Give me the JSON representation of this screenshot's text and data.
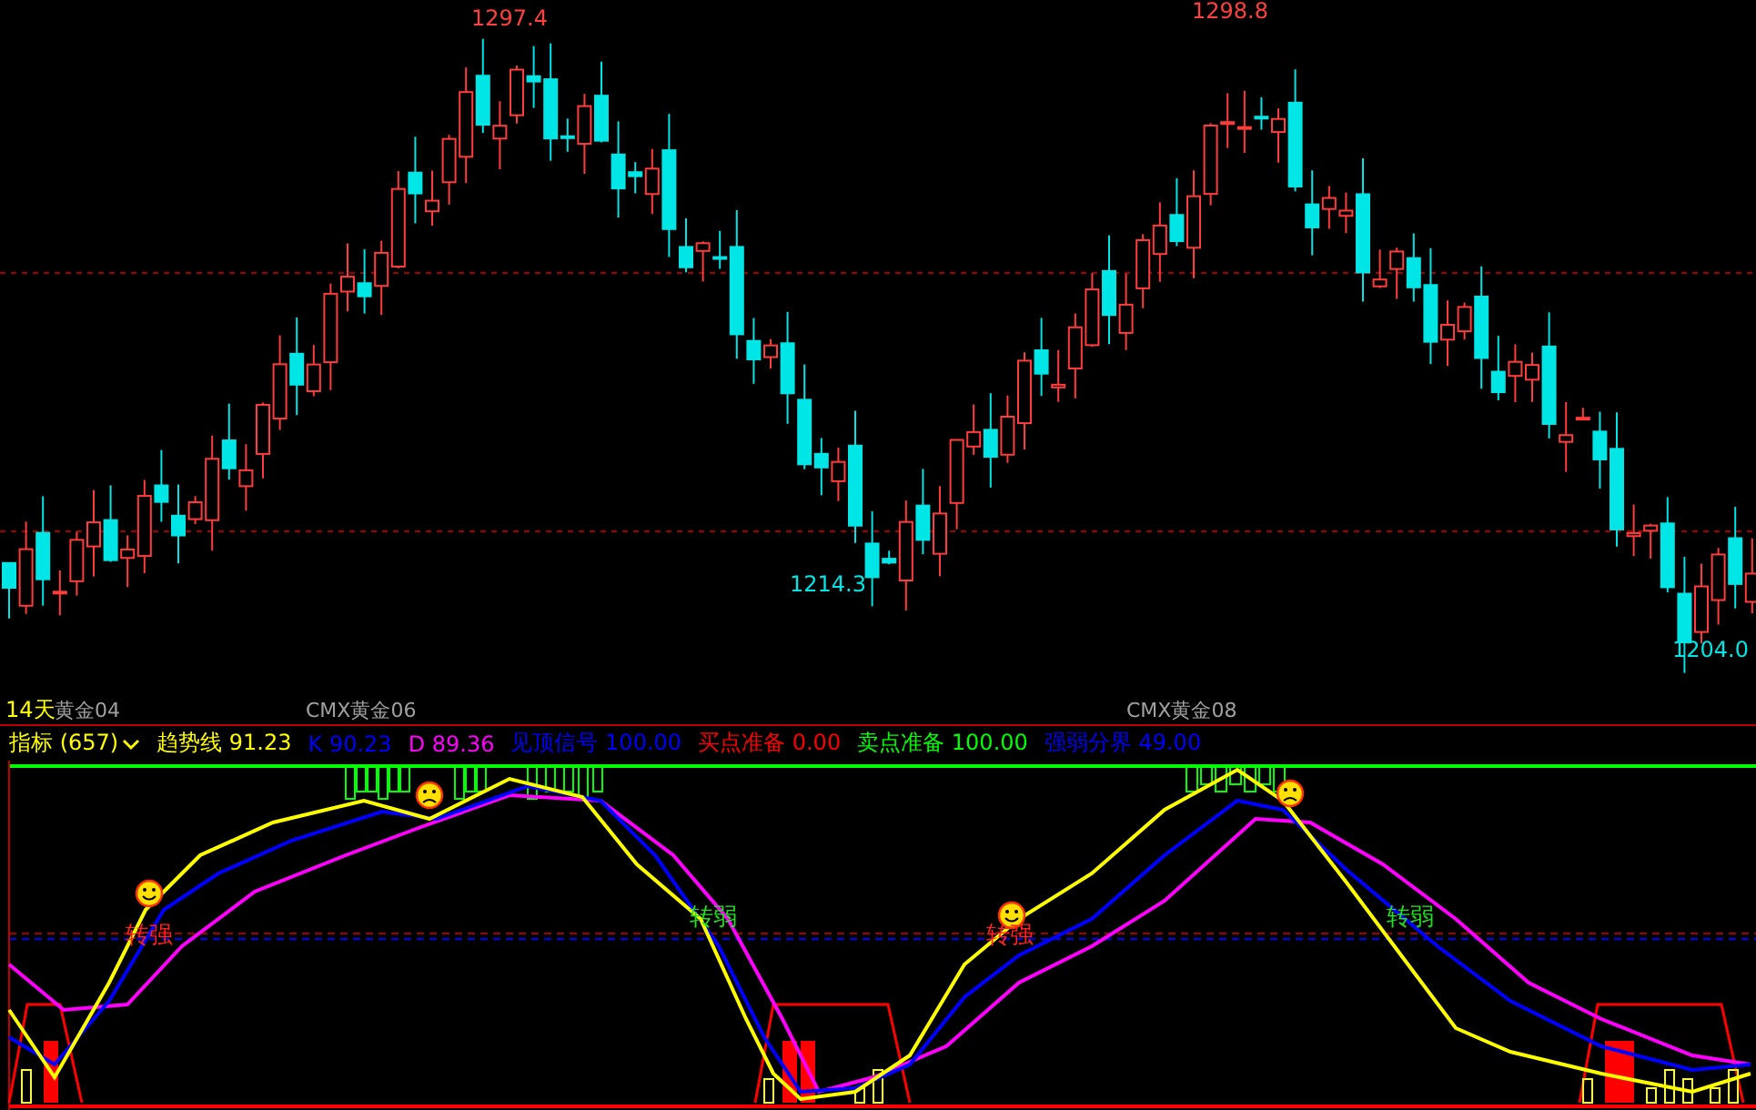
{
  "price_chart": {
    "annotations": [
      {
        "text": "1297.4",
        "kind": "high"
      },
      {
        "text": "1298.8",
        "kind": "high"
      },
      {
        "text": "1214.3",
        "kind": "low"
      },
      {
        "text": "1204.0",
        "kind": "low"
      }
    ]
  },
  "period": "14天",
  "contracts": [
    "黄金04",
    "CMX黄金06",
    "CMX黄金08"
  ],
  "indicator": {
    "title": "指标 (657)",
    "legend": [
      {
        "text": "趋势线 91.23",
        "color": "#ffff00"
      },
      {
        "text": "K 90.23",
        "color": "#0000ff"
      },
      {
        "text": "D 89.36",
        "color": "#ff00ff"
      },
      {
        "text": "见顶信号 100.00",
        "color": "#0000ff"
      },
      {
        "text": "买点准备 0.00",
        "color": "#ff0000"
      },
      {
        "text": "卖点准备 100.00",
        "color": "#00ff00"
      },
      {
        "text": "强弱分界 49.00",
        "color": "#0000ff"
      }
    ],
    "signals": [
      {
        "text": "转强",
        "kind": "strong"
      },
      {
        "text": "转弱",
        "kind": "weak"
      },
      {
        "text": "转强",
        "kind": "strong"
      },
      {
        "text": "转弱",
        "kind": "weak"
      }
    ]
  }
}
